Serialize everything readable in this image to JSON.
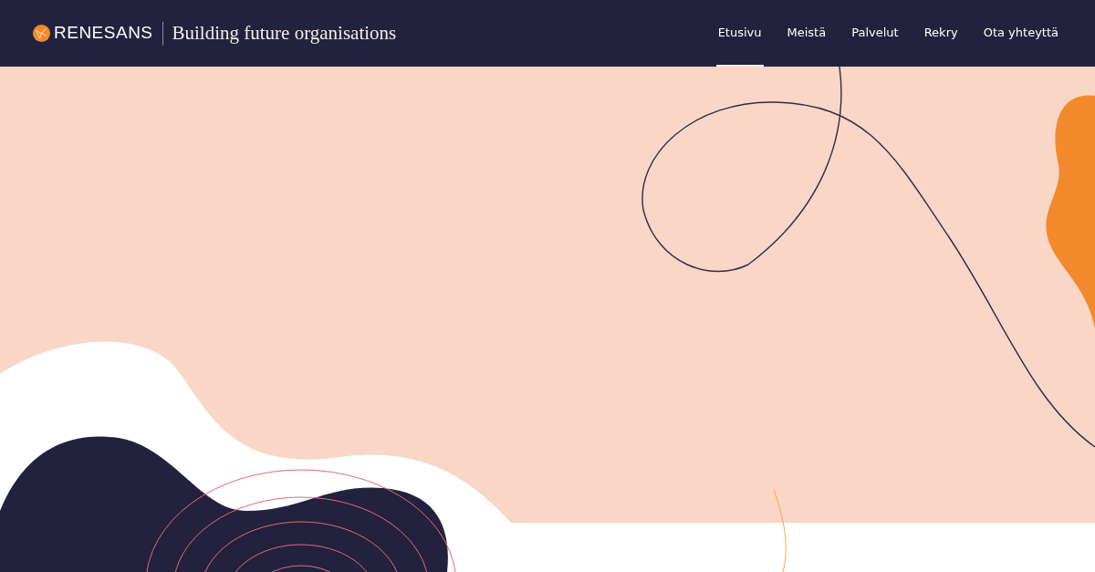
{
  "header": {
    "brand": "RENESANS",
    "tagline": "Building future organisations"
  },
  "nav": [
    {
      "label": "Etusivu",
      "selected": true
    },
    {
      "label": "Meistä",
      "selected": false
    },
    {
      "label": "Palvelut",
      "selected": false
    },
    {
      "label": "Rekry",
      "selected": false
    },
    {
      "label": "Ota yhteyttä",
      "selected": false
    }
  ]
}
